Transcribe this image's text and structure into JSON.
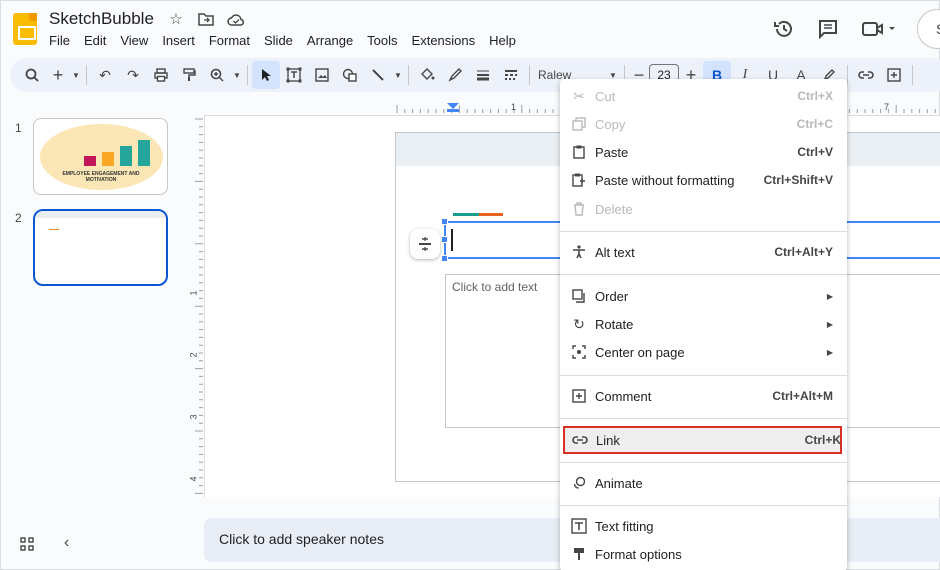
{
  "header": {
    "doc_title": "SketchBubble",
    "menu": [
      "File",
      "Edit",
      "View",
      "Insert",
      "Format",
      "Slide",
      "Arrange",
      "Tools",
      "Extensions",
      "Help"
    ],
    "avatar_letter": "S"
  },
  "toolbar": {
    "font_name": "Ralew",
    "font_size": "23"
  },
  "filmstrip": {
    "slides": [
      {
        "number": "1",
        "caption": "EMPLOYEE ENGAGEMENT AND MOTIVATION"
      },
      {
        "number": "2"
      }
    ]
  },
  "ruler": {
    "h_marks": [
      "1",
      "7"
    ],
    "v_marks": [
      "1",
      "2",
      "3",
      "4"
    ]
  },
  "canvas": {
    "body_placeholder": "Click to add text",
    "speaker_notes_placeholder": "Click to add speaker notes"
  },
  "context_menu": {
    "cut": {
      "label": "Cut",
      "shortcut": "Ctrl+X"
    },
    "copy": {
      "label": "Copy",
      "shortcut": "Ctrl+C"
    },
    "paste": {
      "label": "Paste",
      "shortcut": "Ctrl+V"
    },
    "paste_plain": {
      "label": "Paste without formatting",
      "shortcut": "Ctrl+Shift+V"
    },
    "delete": {
      "label": "Delete"
    },
    "alt_text": {
      "label": "Alt text",
      "shortcut": "Ctrl+Alt+Y"
    },
    "order": {
      "label": "Order"
    },
    "rotate": {
      "label": "Rotate"
    },
    "center": {
      "label": "Center on page"
    },
    "comment": {
      "label": "Comment",
      "shortcut": "Ctrl+Alt+M"
    },
    "link": {
      "label": "Link",
      "shortcut": "Ctrl+K"
    },
    "animate": {
      "label": "Animate"
    },
    "text_fitting": {
      "label": "Text fitting"
    },
    "format_options": {
      "label": "Format options"
    }
  },
  "colors": {
    "accent_blue": "#0b57d0",
    "highlight_red": "#d93025",
    "logo_yellow": "#fbbc04"
  }
}
